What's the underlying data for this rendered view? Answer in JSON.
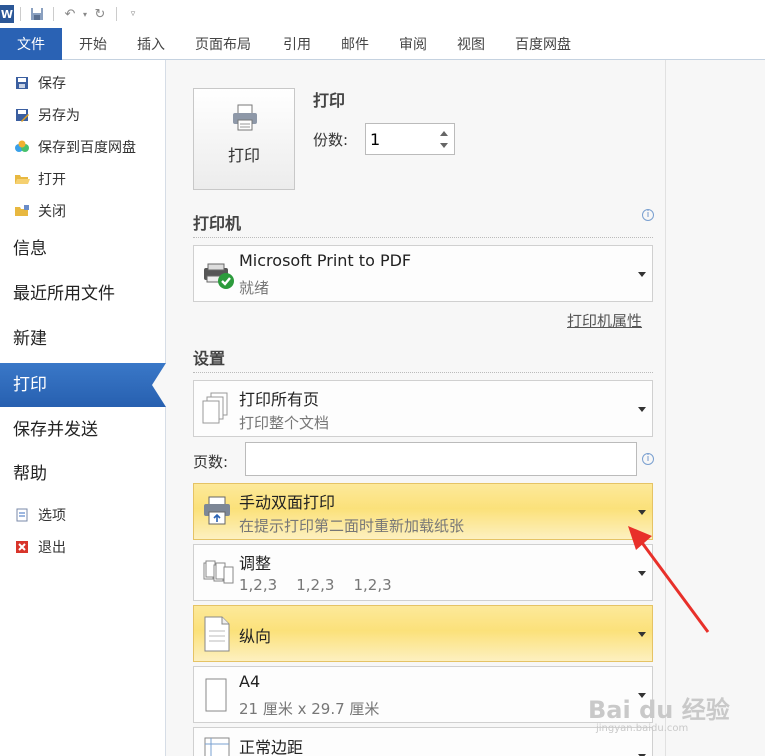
{
  "qat": {
    "app_letter": "W"
  },
  "ribbon": {
    "tabs": [
      {
        "label": "文件"
      },
      {
        "label": "开始"
      },
      {
        "label": "插入"
      },
      {
        "label": "页面布局"
      },
      {
        "label": "引用"
      },
      {
        "label": "邮件"
      },
      {
        "label": "审阅"
      },
      {
        "label": "视图"
      },
      {
        "label": "百度网盘"
      }
    ]
  },
  "nav": {
    "commands": [
      {
        "label": "保存",
        "icon": "save-icon"
      },
      {
        "label": "另存为",
        "icon": "save-as-icon"
      },
      {
        "label": "保存到百度网盘",
        "icon": "baidu-cloud-icon"
      },
      {
        "label": "打开",
        "icon": "open-folder-icon"
      },
      {
        "label": "关闭",
        "icon": "close-folder-icon"
      }
    ],
    "sections": [
      {
        "label": "信息"
      },
      {
        "label": "最近所用文件"
      },
      {
        "label": "新建"
      },
      {
        "label": "打印"
      },
      {
        "label": "保存并发送"
      },
      {
        "label": "帮助"
      }
    ],
    "bottom_commands": [
      {
        "label": "选项",
        "icon": "options-icon"
      },
      {
        "label": "退出",
        "icon": "exit-icon"
      }
    ]
  },
  "print": {
    "heading": "打印",
    "button_label": "打印",
    "copies_label": "份数:",
    "copies_value": "1"
  },
  "printer": {
    "heading": "打印机",
    "name": "Microsoft Print to PDF",
    "status": "就绪",
    "properties_link": "打印机属性"
  },
  "settings": {
    "heading": "设置",
    "print_range": {
      "title": "打印所有页",
      "sub": "打印整个文档"
    },
    "pages_label": "页数:",
    "duplex": {
      "title": "手动双面打印",
      "sub": "在提示打印第二面时重新加载纸张"
    },
    "collate": {
      "title": "调整",
      "sub": "1,2,3    1,2,3    1,2,3"
    },
    "orientation": {
      "title": "纵向"
    },
    "paper": {
      "title": "A4",
      "sub": "21 厘米 x 29.7 厘米"
    },
    "margins": {
      "title": "正常边距"
    }
  },
  "watermark": {
    "text": "Bai du 经验",
    "sub": "jingyan.baidu.com"
  },
  "colors": {
    "accent": "#2a62b4",
    "highlight": "#fbe17a",
    "arrow": "#e8302a"
  }
}
